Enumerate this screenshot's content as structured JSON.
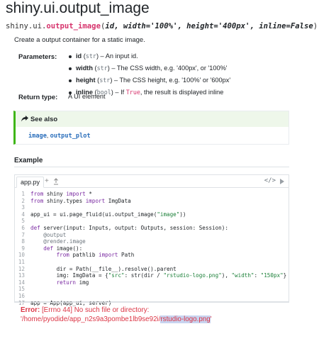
{
  "title": "shiny.ui.output_image",
  "signature": {
    "module": "shiny.ui.",
    "function": "output_image",
    "open_paren": "(",
    "params": "id, width='100%', height='400px', inline=False",
    "close_paren": ")"
  },
  "description": "Create a output container for a static image.",
  "parameters_label": "Parameters:",
  "parameters": [
    {
      "name": "id",
      "open": " (",
      "type": "str",
      "close": ")",
      "desc": " – An input id."
    },
    {
      "name": "width",
      "open": " (",
      "type": "str",
      "close": ")",
      "desc": " – The CSS width, e.g. '400px', or '100%'"
    },
    {
      "name": "height",
      "open": " (",
      "type": "str",
      "close": ")",
      "desc": " – The CSS height, e.g. '100%' or '600px'"
    },
    {
      "name": "inline",
      "open": " (",
      "type": "bool",
      "close": ")",
      "desc_pre": " – If ",
      "keyword": "True",
      "desc_post": ", the result is displayed inline"
    }
  ],
  "return_type_label": "Return type:",
  "return_type": "A UI element",
  "see_also": {
    "label": "See also",
    "links": [
      "image",
      "output_plot"
    ],
    "separator": ", "
  },
  "example": {
    "heading": "Example",
    "tab_label": "app.py",
    "add_icon": "+",
    "upload_icon": "upload-icon",
    "code_icon": "</>",
    "code_lines": [
      {
        "n": "1",
        "t": "from shiny import *"
      },
      {
        "n": "2",
        "t": "from shiny.types import ImgData"
      },
      {
        "n": "3",
        "t": ""
      },
      {
        "n": "4",
        "t": "app_ui = ui.page_fluid(ui.output_image(\"image\"))"
      },
      {
        "n": "5",
        "t": ""
      },
      {
        "n": "6",
        "t": "def server(input: Inputs, output: Outputs, session: Session):"
      },
      {
        "n": "7",
        "t": "    @output"
      },
      {
        "n": "8",
        "t": "    @render.image"
      },
      {
        "n": "9",
        "t": "    def image():"
      },
      {
        "n": "10",
        "t": "        from pathlib import Path"
      },
      {
        "n": "11",
        "t": ""
      },
      {
        "n": "12",
        "t": "        dir = Path(__file__).resolve().parent"
      },
      {
        "n": "13",
        "t": "        img: ImgData = {\"src\": str(dir / \"rstudio-logo.png\"), \"width\": \"150px\"}"
      },
      {
        "n": "14",
        "t": "        return img"
      },
      {
        "n": "15",
        "t": ""
      },
      {
        "n": "16",
        "t": ""
      },
      {
        "n": "17",
        "t": "app = App(app_ui, server)"
      }
    ]
  },
  "error": {
    "label": "Error:",
    "message": " [Errno 44] No such file or directory:",
    "path_pre": "'/home/pyodide/app_n2s9a3pombe1lb9se92i/",
    "path_sel": "rstudio-logo.png",
    "path_post": "'"
  },
  "colors": {
    "function_name": "#d6336c",
    "see_also_accent": "#3fb618",
    "link": "#2a6ebb",
    "error": "#dc3545",
    "keyword": "#7928a1",
    "string": "#1a7f37"
  }
}
